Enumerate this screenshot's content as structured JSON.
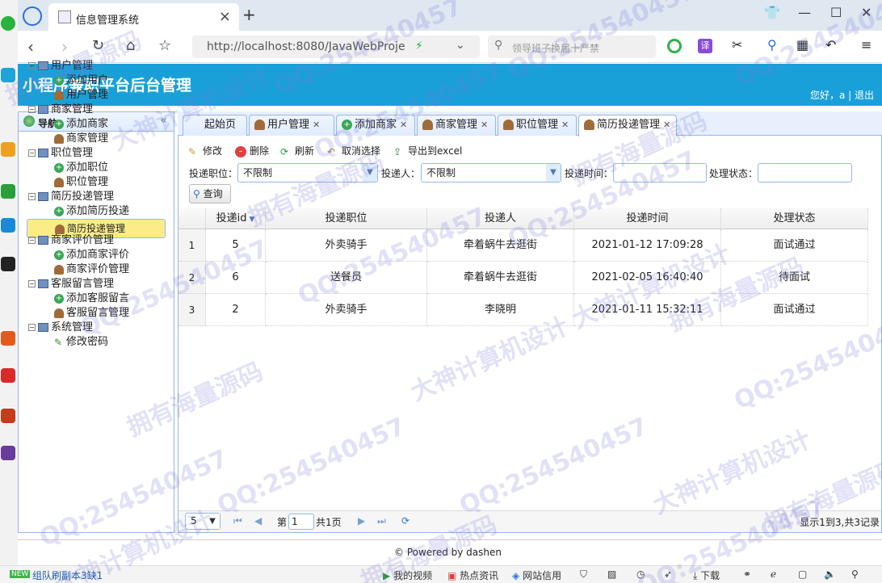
{
  "browser": {
    "tab_title": "信息管理系统",
    "url": "http://localhost:8080/JavaWebProje",
    "search_placeholder": "领导班子换届十严禁"
  },
  "app": {
    "title": "小程序兼职平台后台管理",
    "user_greeting": "您好，a | 退出"
  },
  "nav": {
    "header": "导航",
    "tree": [
      {
        "label": "用户管理",
        "type": "group"
      },
      {
        "label": "添加用户",
        "type": "add"
      },
      {
        "label": "用户管理",
        "type": "person"
      },
      {
        "label": "商家管理",
        "type": "group"
      },
      {
        "label": "添加商家",
        "type": "add"
      },
      {
        "label": "商家管理",
        "type": "person"
      },
      {
        "label": "职位管理",
        "type": "group"
      },
      {
        "label": "添加职位",
        "type": "add"
      },
      {
        "label": "职位管理",
        "type": "person"
      },
      {
        "label": "简历投递管理",
        "type": "group"
      },
      {
        "label": "添加简历投递",
        "type": "add"
      },
      {
        "label": "简历投递管理",
        "type": "person",
        "selected": true
      },
      {
        "label": "商家评价管理",
        "type": "group"
      },
      {
        "label": "添加商家评价",
        "type": "add"
      },
      {
        "label": "商家评价管理",
        "type": "person"
      },
      {
        "label": "客服留言管理",
        "type": "group"
      },
      {
        "label": "添加客服留言",
        "type": "add"
      },
      {
        "label": "客服留言管理",
        "type": "person"
      },
      {
        "label": "系统管理",
        "type": "group"
      },
      {
        "label": "修改密码",
        "type": "pen"
      }
    ]
  },
  "tabs": [
    {
      "label": "起始页",
      "icon": "none",
      "closable": false
    },
    {
      "label": "用户管理",
      "icon": "person",
      "closable": true
    },
    {
      "label": "添加商家",
      "icon": "add",
      "closable": true
    },
    {
      "label": "商家管理",
      "icon": "person",
      "closable": true
    },
    {
      "label": "职位管理",
      "icon": "person",
      "closable": true
    },
    {
      "label": "简历投递管理",
      "icon": "person",
      "closable": true,
      "active": true
    }
  ],
  "toolbar": {
    "edit": "修改",
    "delete": "删除",
    "refresh": "刷新",
    "cancel_select": "取消选择",
    "export": "导出到excel"
  },
  "filters": {
    "position_label": "投递职位：",
    "position_value": "不限制",
    "applicant_label": "投递人：",
    "applicant_value": "不限制",
    "time_label": "投递时间：",
    "status_label": "处理状态：",
    "query": "查询"
  },
  "grid": {
    "columns": [
      "投递id",
      "投递职位",
      "投递人",
      "投递时间",
      "处理状态"
    ],
    "rows": [
      {
        "rownum": "1",
        "id": "5",
        "position": "外卖骑手",
        "applicant": "牵着蜗牛去逛街",
        "time": "2021-01-12 17:09:28",
        "status": "面试通过"
      },
      {
        "rownum": "2",
        "id": "6",
        "position": "送餐员",
        "applicant": "牵着蜗牛去逛街",
        "time": "2021-02-05 16:40:40",
        "status": "待面试"
      },
      {
        "rownum": "3",
        "id": "2",
        "position": "外卖骑手",
        "applicant": "李晓明",
        "time": "2021-01-11 15:32:11",
        "status": "面试通过"
      }
    ]
  },
  "pager": {
    "page_size": "5",
    "page_prefix": "第",
    "page_value": "1",
    "page_total": "共1页",
    "summary": "显示1到3,共3记录"
  },
  "footer": {
    "text": "© Powered by dashen"
  },
  "statusbar": {
    "left": "组队刷副本3缺1",
    "new_badge": "NEW",
    "video": "我的视频",
    "news": "热点资讯",
    "credit": "网站信用",
    "download": "下载"
  },
  "watermarks": [
    "QQ:254540457",
    "大神计算机设计",
    "拥有海量源码"
  ]
}
